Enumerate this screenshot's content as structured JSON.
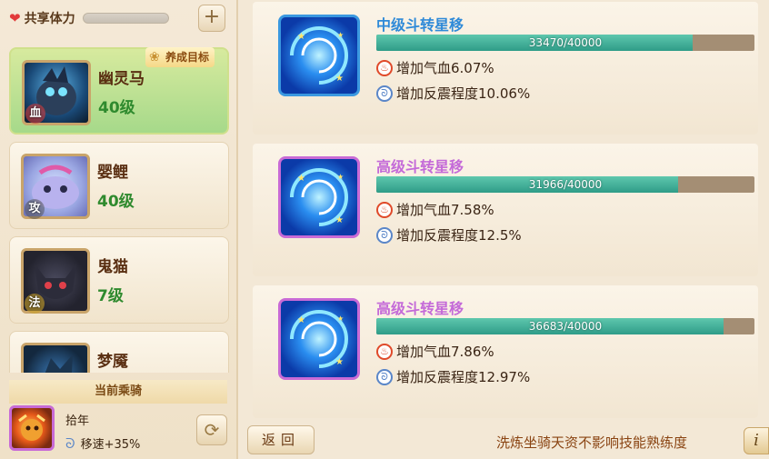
{
  "stamina": {
    "label": "共享体力",
    "plus": "+"
  },
  "goal_tag": "养成目标",
  "mounts": [
    {
      "name": "幽灵马",
      "level": "40级",
      "badge": "血"
    },
    {
      "name": "婴鲤",
      "level": "40级",
      "badge": "攻"
    },
    {
      "name": "鬼猫",
      "level": "7级",
      "badge": "法"
    },
    {
      "name": "梦魇",
      "level": "",
      "badge": ""
    }
  ],
  "current": {
    "title": "当前乘骑",
    "name": "拾年",
    "speed": "移速+35%"
  },
  "skills": [
    {
      "title": "中级斗转星移",
      "title_color": "#2f8ad8",
      "progress": "33470/40000",
      "progress_value": 0.8368,
      "effect1": "增加气血6.07%",
      "effect2": "增加反震程度10.06%",
      "frame_color": "#3a98e0"
    },
    {
      "title": "高级斗转星移",
      "title_color": "#c46ad8",
      "progress": "31966/40000",
      "progress_value": 0.7992,
      "effect1": "增加气血7.58%",
      "effect2": "增加反震程度12.5%",
      "frame_color": "#c86ad6"
    },
    {
      "title": "高级斗转星移",
      "title_color": "#c46ad8",
      "progress": "36683/40000",
      "progress_value": 0.9171,
      "effect1": "增加气血7.86%",
      "effect2": "增加反震程度12.97%",
      "frame_color": "#c86ad6"
    }
  ],
  "back_label": "返回",
  "footer_note": "洗炼坐骑天资不影响技能熟练度",
  "info_label": "i"
}
